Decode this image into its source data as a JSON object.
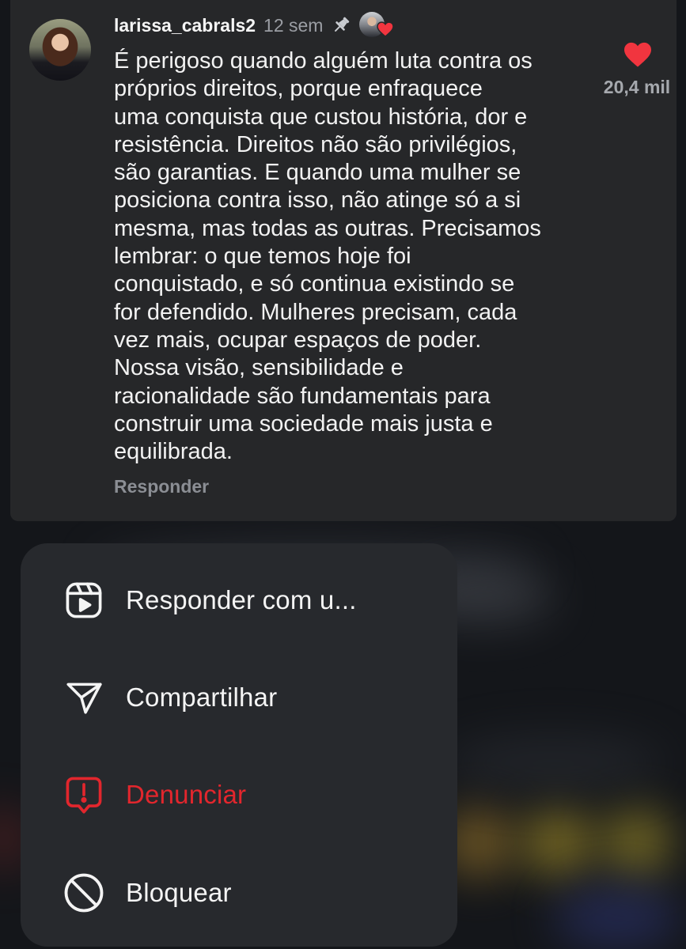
{
  "comment": {
    "username": "larissa_cabrals2",
    "time": "12 sem",
    "icons": {
      "pin": "pin-icon",
      "creator_liked": "creator-liked-avatar",
      "like": "heart-icon"
    },
    "text": "É perigoso quando alguém luta contra os\npróprios direitos, porque enfraquece\numa conquista que custou história, dor e\nresistência. Direitos não são privilégios,\nsão garantias. E quando uma mulher se\nposiciona contra isso, não atinge só a si\nmesma, mas todas as outras. Precisamos\nlembrar: o que temos hoje foi\nconquistado, e só continua existindo se\nfor defendido. Mulheres precisam, cada\nvez mais, ocupar espaços de poder.\nNossa visão, sensibilidade e\nracionalidade são fundamentais para\nconstruir uma sociedade mais justa e\nequilibrada.",
    "reply_label": "Responder",
    "like_count": "20,4 mil"
  },
  "menu": {
    "items": [
      {
        "label": "Responder com u...",
        "icon": "reels-icon",
        "color": "#f4f4f4"
      },
      {
        "label": "Compartilhar",
        "icon": "send-icon",
        "color": "#f4f4f4"
      },
      {
        "label": "Denunciar",
        "icon": "report-icon",
        "color": "#e2262d"
      },
      {
        "label": "Bloquear",
        "icon": "block-icon",
        "color": "#f4f4f4"
      }
    ]
  },
  "colors": {
    "background": "#14161a",
    "card": "#262729",
    "menu": "#27292d",
    "danger": "#e2262d",
    "like": "#f1353f"
  }
}
